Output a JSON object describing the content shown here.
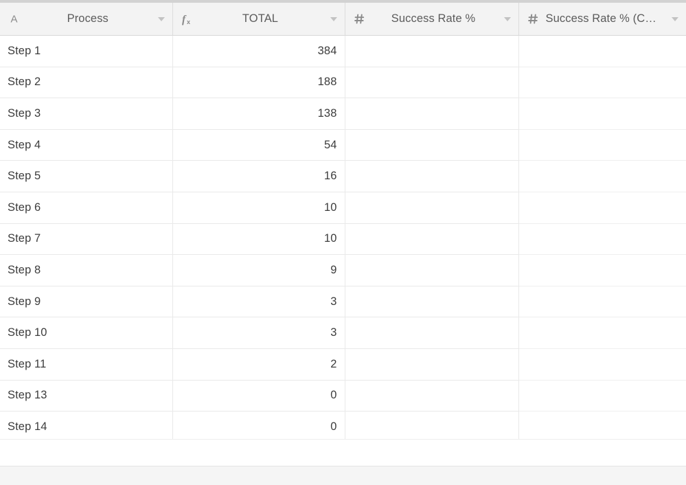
{
  "grid": {
    "columns": [
      {
        "label": "Process",
        "icon": "text-field-icon",
        "icon_glyph": "A",
        "align": "left"
      },
      {
        "label": "TOTAL",
        "icon": "formula-icon",
        "icon_glyph": "fx",
        "align": "right"
      },
      {
        "label": "Success Rate %",
        "icon": "number-field-icon",
        "icon_glyph": "#",
        "align": "right"
      },
      {
        "label": "Success Rate % (CUM)",
        "icon": "number-field-icon",
        "icon_glyph": "#",
        "align": "right"
      }
    ],
    "rows": [
      {
        "process": "Step 1",
        "total": "384",
        "success_rate": "",
        "success_rate_cum": ""
      },
      {
        "process": "Step 2",
        "total": "188",
        "success_rate": "",
        "success_rate_cum": ""
      },
      {
        "process": "Step 3",
        "total": "138",
        "success_rate": "",
        "success_rate_cum": ""
      },
      {
        "process": "Step 4",
        "total": "54",
        "success_rate": "",
        "success_rate_cum": ""
      },
      {
        "process": "Step 5",
        "total": "16",
        "success_rate": "",
        "success_rate_cum": ""
      },
      {
        "process": "Step 6",
        "total": "10",
        "success_rate": "",
        "success_rate_cum": ""
      },
      {
        "process": "Step 7",
        "total": "10",
        "success_rate": "",
        "success_rate_cum": ""
      },
      {
        "process": "Step 8",
        "total": "9",
        "success_rate": "",
        "success_rate_cum": ""
      },
      {
        "process": "Step 9",
        "total": "3",
        "success_rate": "",
        "success_rate_cum": ""
      },
      {
        "process": "Step 10",
        "total": "3",
        "success_rate": "",
        "success_rate_cum": ""
      },
      {
        "process": "Step 11",
        "total": "2",
        "success_rate": "",
        "success_rate_cum": ""
      },
      {
        "process": "Step 13",
        "total": "0",
        "success_rate": "",
        "success_rate_cum": ""
      },
      {
        "process": "Step 14",
        "total": "0",
        "success_rate": "",
        "success_rate_cum": ""
      }
    ]
  },
  "colors": {
    "header_background": "#f3f3f3",
    "header_text": "#5b5b5b",
    "cell_text": "#3c3c3c",
    "row_border": "#e9e9e9",
    "column_border": "#dcdcdc",
    "top_strip": "#d2d2d2",
    "footer_band": "#f5f5f5"
  }
}
